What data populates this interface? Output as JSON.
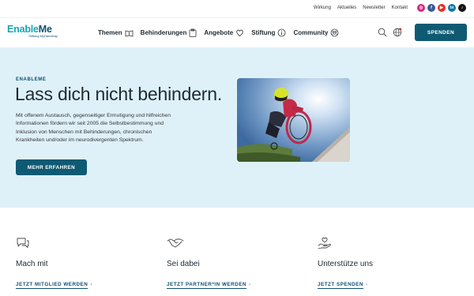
{
  "topbar": {
    "links": [
      "Wirkung",
      "Aktuelles",
      "Newsletter",
      "Kontakt"
    ],
    "socials": [
      {
        "icon": "instagram-icon",
        "color": "#d6297c",
        "glyph": "◎"
      },
      {
        "icon": "facebook-icon",
        "color": "#3b5998",
        "glyph": "f"
      },
      {
        "icon": "youtube-icon",
        "color": "#e52d27",
        "glyph": "▶"
      },
      {
        "icon": "linkedin-icon",
        "color": "#0e76a8",
        "glyph": "in"
      },
      {
        "icon": "tiktok-icon",
        "color": "#111111",
        "glyph": "♪"
      }
    ]
  },
  "header": {
    "logo_main_a": "Enable",
    "logo_main_b": "Me",
    "logo_sub": "Stiftung MyHandicap",
    "nav": [
      {
        "label": "Themen",
        "icon": "book-icon"
      },
      {
        "label": "Behinderungen",
        "icon": "clipboard-icon"
      },
      {
        "label": "Angebote",
        "icon": "heart-hand-icon"
      },
      {
        "label": "Stiftung",
        "icon": "info-icon"
      },
      {
        "label": "Community",
        "icon": "people-icon"
      }
    ],
    "donate_label": "SPENDEN"
  },
  "hero": {
    "eyebrow": "ENABLEME",
    "title": "Lass dich nicht behindern.",
    "text": "Mit offenem Austausch, gegenseitiger Ermutigung und hilfreichen Informationen fördern wir seit 2005 die Selbstbestimmung und Inklusion von Menschen mit Behinderungen, chronischen Krankheiten und/oder im neurodivergenten Spektrum.",
    "button_label": "MEHR ERFAHREN"
  },
  "cards": [
    {
      "icon": "chat-bubbles-icon",
      "title": "Mach mit",
      "link": "JETZT MITGLIED WERDEN"
    },
    {
      "icon": "handshake-icon",
      "title": "Sei dabei",
      "link": "JETZT PARTNER*IN WERDEN"
    },
    {
      "icon": "hand-heart-icon",
      "title": "Unterstütze uns",
      "link": "JETZT SPENDEN"
    }
  ],
  "colors": {
    "brand_teal": "#1aa5b5",
    "brand_navy": "#0d4f72",
    "button": "#0f5a73",
    "hero_bg": "#dff1f8"
  }
}
